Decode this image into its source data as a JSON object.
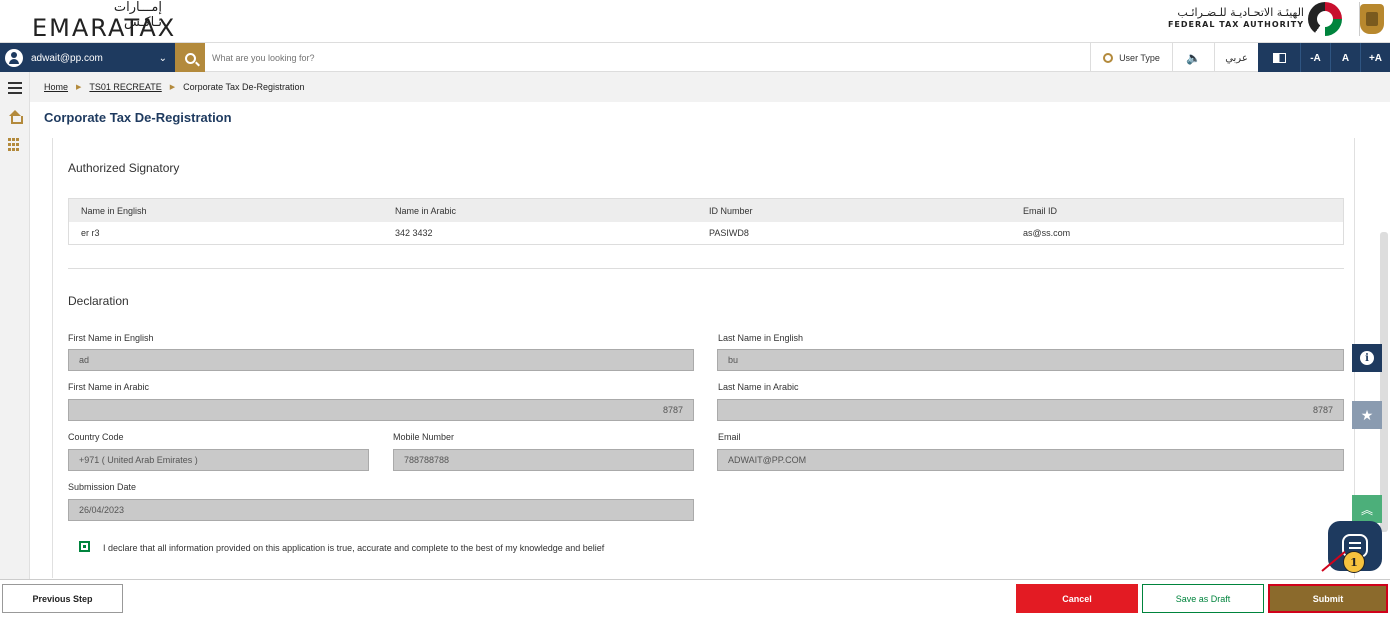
{
  "header": {
    "logo_ar": "إمـــارات تـاكـس",
    "logo_en": "EMARATAX",
    "authority_ar": "الهيئـة الاتحـاديـة للـضـرائـب",
    "authority_en": "FEDERAL TAX AUTHORITY"
  },
  "navbar": {
    "user_email": "adwait@pp.com",
    "search_placeholder": "What are you looking for?",
    "user_type_label": "User Type",
    "speaker_glyph": "🔈",
    "language_label": "عربي",
    "font_decrease": "-A",
    "font_normal": "A",
    "font_increase": "+A"
  },
  "breadcrumb": {
    "home": "Home",
    "parent": "TS01 RECREATE",
    "current": "Corporate Tax De-Registration",
    "separator": "▶"
  },
  "page_title": "Corporate Tax De-Registration",
  "authorized_signatory": {
    "title": "Authorized Signatory",
    "columns": [
      "Name in English",
      "Name in Arabic",
      "ID Number",
      "Email ID"
    ],
    "rows": [
      [
        "er r3",
        "342 3432",
        "PASIWD8",
        "as@ss.com"
      ]
    ]
  },
  "declaration": {
    "title": "Declaration",
    "first_name_en_label": "First Name in English",
    "first_name_en": "ad",
    "last_name_en_label": "Last Name in English",
    "last_name_en": "bu",
    "first_name_ar_label": "First Name in Arabic",
    "first_name_ar": "8787",
    "last_name_ar_label": "Last Name in Arabic",
    "last_name_ar": "8787",
    "country_code_label": "Country Code",
    "country_code": "+971 ( United Arab Emirates )",
    "mobile_label": "Mobile Number",
    "mobile": "788788788",
    "email_label": "Email",
    "email": "ADWAIT@PP.COM",
    "submission_date_label": "Submission Date",
    "submission_date": "26/04/2023",
    "agree_text": "I declare that all information provided on this application is true, accurate and complete to the best of my knowledge and belief",
    "agree_checked": true
  },
  "floating": {
    "info_glyph": "i",
    "star_glyph": "★",
    "up_glyph": "︽",
    "badge": "1"
  },
  "footer": {
    "previous": "Previous Step",
    "cancel": "Cancel",
    "save_draft": "Save as Draft",
    "submit": "Submit"
  },
  "colors": {
    "navy": "#1e3a5f",
    "gold": "#b38a3c",
    "cancel_red": "#e31b23",
    "draft_green": "#00843d",
    "submit_brown": "#8b6a2c"
  }
}
